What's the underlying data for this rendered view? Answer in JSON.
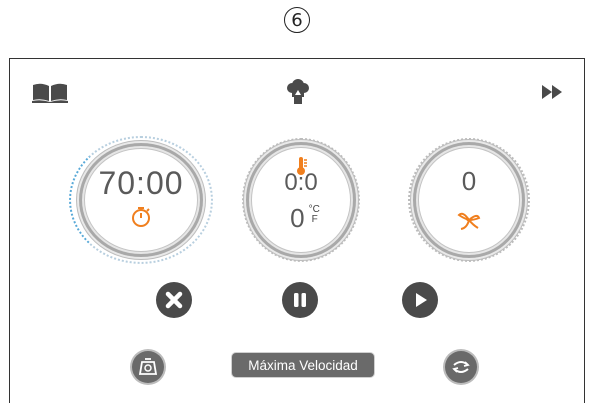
{
  "step_number": "6",
  "header": {
    "icons": [
      "recipe-book-icon",
      "chef-hat-icon",
      "fast-forward-icon"
    ]
  },
  "dials": {
    "time": {
      "value": "70:00",
      "icon": "stopwatch-icon"
    },
    "temperature": {
      "value_top": "0:0",
      "value_bottom": "0",
      "unit_c": "°C",
      "unit_f": "F",
      "icon": "thermometer-icon"
    },
    "speed": {
      "value": "0",
      "icon": "fan-blade-icon"
    }
  },
  "controls": {
    "icons": [
      "cancel-icon",
      "pause-icon",
      "play-icon"
    ]
  },
  "bottom": {
    "scale_icon": "scale-icon",
    "status_label": "Máxima Velocidad",
    "reverse_icon": "reverse-rotation-icon"
  },
  "colors": {
    "accent_orange": "#f07f1e",
    "dial_dots_blue": "#58a9d8",
    "button_dark": "#4a4a4a"
  }
}
